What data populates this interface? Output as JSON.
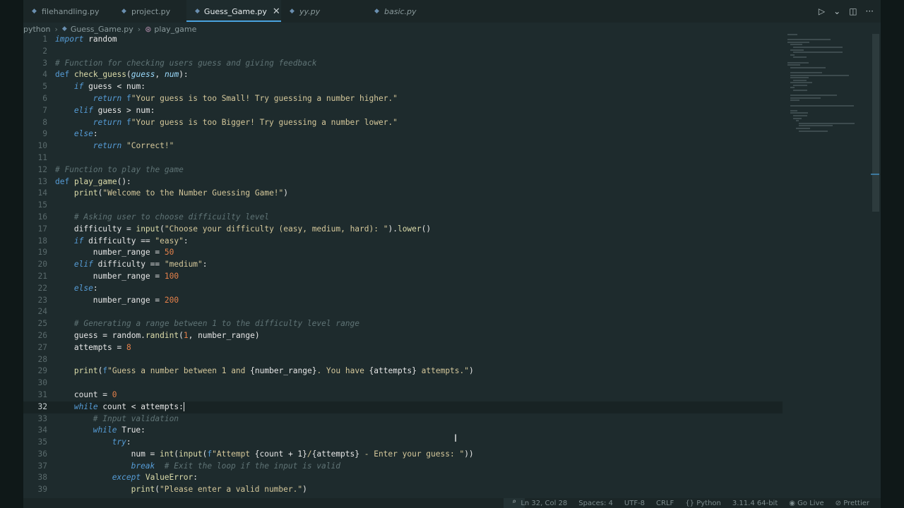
{
  "tabs": [
    {
      "label": "filehandling.py",
      "icon": "python-file-icon",
      "active": false,
      "italic": false
    },
    {
      "label": "project.py",
      "icon": "python-file-icon",
      "active": false,
      "italic": false
    },
    {
      "label": "Guess_Game.py",
      "icon": "python-file-icon",
      "active": true,
      "italic": false,
      "close": "✕"
    },
    {
      "label": "yy.py",
      "icon": "python-file-icon",
      "active": false,
      "italic": true
    },
    {
      "label": "basic.py",
      "icon": "python-file-icon",
      "active": false,
      "italic": true
    }
  ],
  "tab_actions": {
    "run": "▷",
    "run_menu": "⌄",
    "split": "◫",
    "more": "···"
  },
  "breadcrumb": {
    "folder": "python",
    "file": "Guess_Game.py",
    "symbol": "play_game"
  },
  "status": {
    "position": "Ln 32, Col 28",
    "spaces": "Spaces: 4",
    "encoding": "UTF-8",
    "eol": "CRLF",
    "language": "Python",
    "interpreter": "3.11.4 64-bit",
    "golive": "Go Live",
    "prettier": "Prettier"
  },
  "code": [
    {
      "n": "1",
      "i": 0,
      "t": [
        [
          "kw",
          "import"
        ],
        [
          "plain",
          " random"
        ]
      ]
    },
    {
      "n": "2",
      "i": 0,
      "t": []
    },
    {
      "n": "3",
      "i": 0,
      "t": [
        [
          "cm",
          "# Function for checking users guess and giving feedback"
        ]
      ]
    },
    {
      "n": "4",
      "i": 0,
      "t": [
        [
          "def",
          "def "
        ],
        [
          "fn",
          "check_guess"
        ],
        [
          "plain",
          "("
        ],
        [
          "par",
          "guess"
        ],
        [
          "plain",
          ", "
        ],
        [
          "par",
          "num"
        ],
        [
          "plain",
          "):"
        ]
      ]
    },
    {
      "n": "5",
      "i": 1,
      "t": [
        [
          "kw",
          "if"
        ],
        [
          "plain",
          " guess < num:"
        ]
      ]
    },
    {
      "n": "6",
      "i": 2,
      "t": [
        [
          "kw",
          "return"
        ],
        [
          "plain",
          " "
        ],
        [
          "def",
          "f"
        ],
        [
          "str",
          "\"Your guess is too Small! Try guessing a number higher.\""
        ]
      ]
    },
    {
      "n": "7",
      "i": 1,
      "t": [
        [
          "kw",
          "elif"
        ],
        [
          "plain",
          " guess > num:"
        ]
      ]
    },
    {
      "n": "8",
      "i": 2,
      "t": [
        [
          "kw",
          "return"
        ],
        [
          "plain",
          " "
        ],
        [
          "def",
          "f"
        ],
        [
          "str",
          "\"Your guess is too Bigger! Try guessing a number lower.\""
        ]
      ]
    },
    {
      "n": "9",
      "i": 1,
      "t": [
        [
          "kw",
          "else"
        ],
        [
          "plain",
          ":"
        ]
      ]
    },
    {
      "n": "10",
      "i": 2,
      "t": [
        [
          "kw",
          "return"
        ],
        [
          "plain",
          " "
        ],
        [
          "str",
          "\"Correct!\""
        ]
      ]
    },
    {
      "n": "11",
      "i": 0,
      "t": []
    },
    {
      "n": "12",
      "i": 0,
      "t": [
        [
          "cm",
          "# Function to play the game"
        ]
      ]
    },
    {
      "n": "13",
      "i": 0,
      "t": [
        [
          "def",
          "def "
        ],
        [
          "fn",
          "play_game"
        ],
        [
          "plain",
          "():"
        ]
      ]
    },
    {
      "n": "14",
      "i": 1,
      "t": [
        [
          "bi",
          "print"
        ],
        [
          "plain",
          "("
        ],
        [
          "str",
          "\"Welcome to the Number Guessing Game!\""
        ],
        [
          "plain",
          ")"
        ]
      ]
    },
    {
      "n": "15",
      "i": 0,
      "t": []
    },
    {
      "n": "16",
      "i": 1,
      "t": [
        [
          "cm",
          "# Asking user to choose difficuilty level"
        ]
      ]
    },
    {
      "n": "17",
      "i": 1,
      "t": [
        [
          "plain",
          "difficulty = "
        ],
        [
          "bi",
          "input"
        ],
        [
          "plain",
          "("
        ],
        [
          "str",
          "\"Choose your difficulty (easy, medium, hard): \""
        ],
        [
          "plain",
          ")."
        ],
        [
          "fn",
          "lower"
        ],
        [
          "plain",
          "()"
        ]
      ]
    },
    {
      "n": "18",
      "i": 1,
      "t": [
        [
          "kw",
          "if"
        ],
        [
          "plain",
          " difficulty == "
        ],
        [
          "str",
          "\"easy\""
        ],
        [
          "plain",
          ":"
        ]
      ]
    },
    {
      "n": "19",
      "i": 2,
      "t": [
        [
          "plain",
          "number_range = "
        ],
        [
          "num",
          "50"
        ]
      ]
    },
    {
      "n": "20",
      "i": 1,
      "t": [
        [
          "kw",
          "elif"
        ],
        [
          "plain",
          " difficulty == "
        ],
        [
          "str",
          "\"medium\""
        ],
        [
          "plain",
          ":"
        ]
      ]
    },
    {
      "n": "21",
      "i": 2,
      "t": [
        [
          "plain",
          "number_range = "
        ],
        [
          "num",
          "100"
        ]
      ]
    },
    {
      "n": "22",
      "i": 1,
      "t": [
        [
          "kw",
          "else"
        ],
        [
          "plain",
          ":"
        ]
      ]
    },
    {
      "n": "23",
      "i": 2,
      "t": [
        [
          "plain",
          "number_range = "
        ],
        [
          "num",
          "200"
        ]
      ]
    },
    {
      "n": "24",
      "i": 0,
      "t": []
    },
    {
      "n": "25",
      "i": 1,
      "t": [
        [
          "cm",
          "# Generating a range between 1 to the difficulty level range"
        ]
      ]
    },
    {
      "n": "26",
      "i": 1,
      "t": [
        [
          "plain",
          "guess = random."
        ],
        [
          "fn",
          "randint"
        ],
        [
          "plain",
          "("
        ],
        [
          "num",
          "1"
        ],
        [
          "plain",
          ", number_range)"
        ]
      ]
    },
    {
      "n": "27",
      "i": 1,
      "t": [
        [
          "plain",
          "attempts = "
        ],
        [
          "num",
          "8"
        ]
      ]
    },
    {
      "n": "28",
      "i": 0,
      "t": []
    },
    {
      "n": "29",
      "i": 1,
      "t": [
        [
          "bi",
          "print"
        ],
        [
          "plain",
          "("
        ],
        [
          "def",
          "f"
        ],
        [
          "str",
          "\"Guess a number between 1 and "
        ],
        [
          "plain",
          "{number_range}"
        ],
        [
          "str",
          ". You have "
        ],
        [
          "plain",
          "{attempts}"
        ],
        [
          "str",
          " attempts.\""
        ],
        [
          "plain",
          ")"
        ]
      ]
    },
    {
      "n": "30",
      "i": 0,
      "t": []
    },
    {
      "n": "31",
      "i": 1,
      "t": [
        [
          "plain",
          "count = "
        ],
        [
          "num",
          "0"
        ]
      ]
    },
    {
      "n": "32",
      "i": 1,
      "t": [
        [
          "kw",
          "while"
        ],
        [
          "plain",
          " count < attempts:"
        ]
      ],
      "current": true
    },
    {
      "n": "33",
      "i": 2,
      "t": [
        [
          "cm",
          "# Input validation"
        ]
      ]
    },
    {
      "n": "34",
      "i": 2,
      "t": [
        [
          "kw",
          "while"
        ],
        [
          "plain",
          " True:"
        ]
      ]
    },
    {
      "n": "35",
      "i": 3,
      "t": [
        [
          "kw",
          "try"
        ],
        [
          "plain",
          ":"
        ]
      ]
    },
    {
      "n": "36",
      "i": 4,
      "t": [
        [
          "plain",
          "num = "
        ],
        [
          "bi",
          "int"
        ],
        [
          "plain",
          "("
        ],
        [
          "bi",
          "input"
        ],
        [
          "plain",
          "("
        ],
        [
          "def",
          "f"
        ],
        [
          "str",
          "\"Attempt "
        ],
        [
          "plain",
          "{count + 1}"
        ],
        [
          "str",
          "/"
        ],
        [
          "plain",
          "{attempts}"
        ],
        [
          "str",
          " - Enter your guess: \""
        ],
        [
          "plain",
          "))"
        ]
      ]
    },
    {
      "n": "37",
      "i": 4,
      "t": [
        [
          "kw",
          "break"
        ],
        [
          "plain",
          "  "
        ],
        [
          "cm",
          "# Exit the loop if the input is valid"
        ]
      ]
    },
    {
      "n": "38",
      "i": 3,
      "t": [
        [
          "kw",
          "except"
        ],
        [
          "plain",
          " "
        ],
        [
          "fn",
          "ValueError"
        ],
        [
          "plain",
          ":"
        ]
      ]
    },
    {
      "n": "39",
      "i": 4,
      "t": [
        [
          "bi",
          "print"
        ],
        [
          "plain",
          "("
        ],
        [
          "str",
          "\"Please enter a valid number.\""
        ],
        [
          "plain",
          ")"
        ]
      ]
    }
  ]
}
